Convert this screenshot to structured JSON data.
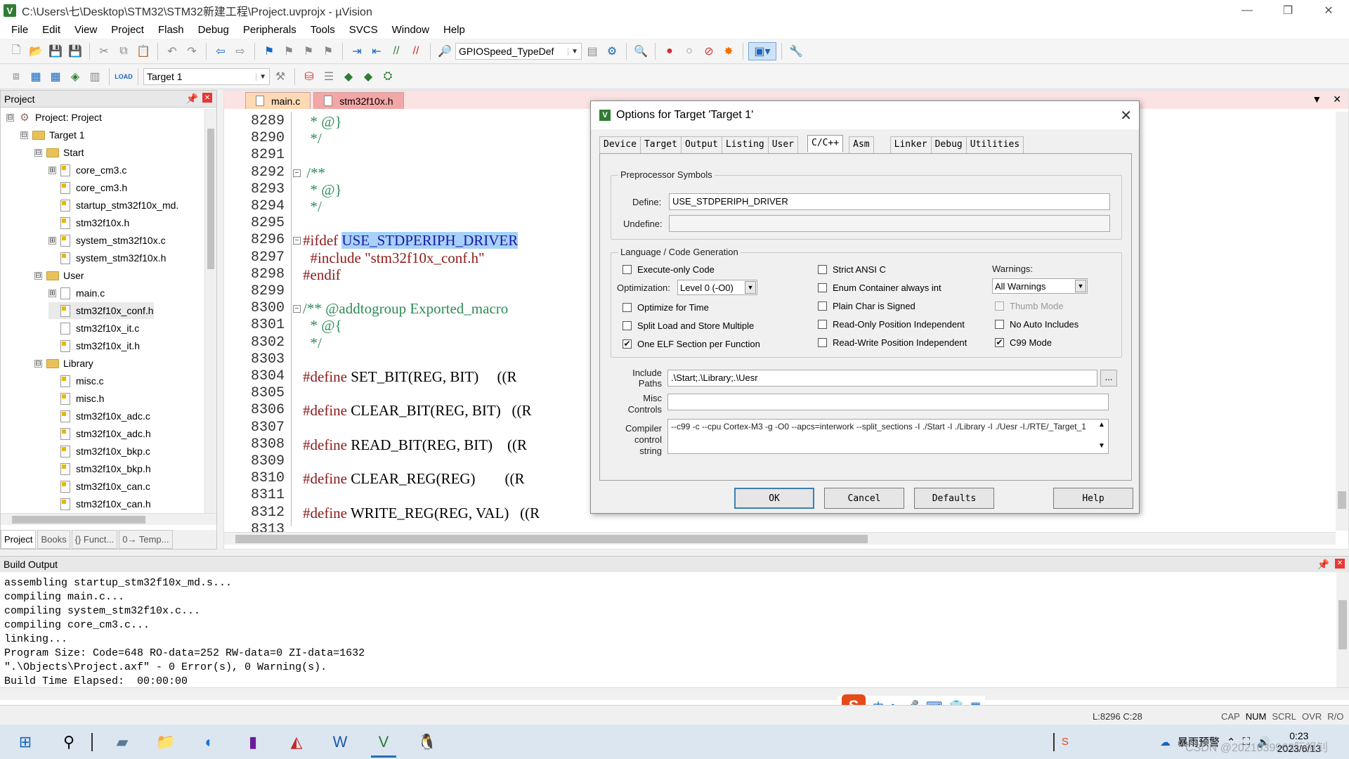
{
  "window": {
    "title": "C:\\Users\\七\\Desktop\\STM32\\STM32新建工程\\Project.uvprojx - µVision",
    "app_icon": "V",
    "minimize": "—",
    "restore": "❐",
    "close": "✕"
  },
  "menu": [
    "File",
    "Edit",
    "View",
    "Project",
    "Flash",
    "Debug",
    "Peripherals",
    "Tools",
    "SVCS",
    "Window",
    "Help"
  ],
  "toolbar": {
    "find_combo": "GPIOSpeed_TypeDef",
    "target_combo": "Target 1",
    "load_label": "LOAD"
  },
  "project_panel": {
    "title": "Project",
    "tree": [
      {
        "label": "Project: Project",
        "level": 0,
        "kind": "project",
        "exp": "⊟"
      },
      {
        "label": "Target 1",
        "level": 1,
        "kind": "target",
        "exp": "⊟"
      },
      {
        "label": "Start",
        "level": 2,
        "kind": "folder",
        "exp": "⊟"
      },
      {
        "label": "core_cm3.c",
        "level": 3,
        "kind": "file",
        "exp": "⊞"
      },
      {
        "label": "core_cm3.h",
        "level": 3,
        "kind": "file",
        "exp": ""
      },
      {
        "label": "startup_stm32f10x_md.",
        "level": 3,
        "kind": "file",
        "exp": ""
      },
      {
        "label": "stm32f10x.h",
        "level": 3,
        "kind": "file",
        "exp": ""
      },
      {
        "label": "system_stm32f10x.c",
        "level": 3,
        "kind": "file",
        "exp": "⊞"
      },
      {
        "label": "system_stm32f10x.h",
        "level": 3,
        "kind": "file",
        "exp": ""
      },
      {
        "label": "User",
        "level": 2,
        "kind": "folder",
        "exp": "⊟"
      },
      {
        "label": "main.c",
        "level": 3,
        "kind": "file",
        "exp": "⊞"
      },
      {
        "label": "stm32f10x_conf.h",
        "level": 3,
        "kind": "file",
        "exp": ""
      },
      {
        "label": "stm32f10x_it.c",
        "level": 3,
        "kind": "file",
        "exp": ""
      },
      {
        "label": "stm32f10x_it.h",
        "level": 3,
        "kind": "file",
        "exp": ""
      },
      {
        "label": "Library",
        "level": 2,
        "kind": "folder",
        "exp": "⊟"
      },
      {
        "label": "misc.c",
        "level": 3,
        "kind": "file",
        "exp": ""
      },
      {
        "label": "misc.h",
        "level": 3,
        "kind": "file",
        "exp": ""
      },
      {
        "label": "stm32f10x_adc.c",
        "level": 3,
        "kind": "file",
        "exp": ""
      },
      {
        "label": "stm32f10x_adc.h",
        "level": 3,
        "kind": "file",
        "exp": ""
      },
      {
        "label": "stm32f10x_bkp.c",
        "level": 3,
        "kind": "file",
        "exp": ""
      },
      {
        "label": "stm32f10x_bkp.h",
        "level": 3,
        "kind": "file",
        "exp": ""
      },
      {
        "label": "stm32f10x_can.c",
        "level": 3,
        "kind": "file",
        "exp": ""
      },
      {
        "label": "stm32f10x_can.h",
        "level": 3,
        "kind": "file",
        "exp": ""
      }
    ],
    "tabs": [
      "Project",
      "Books",
      "{} Funct...",
      "0→ Temp..."
    ]
  },
  "editor": {
    "tabs": [
      "main.c",
      "stm32f10x.h"
    ],
    "active_tab": "stm32f10x.h",
    "lines": [
      {
        "n": "8289",
        "text": "  * @}"
      },
      {
        "n": "8290",
        "text": "  */"
      },
      {
        "n": "8291",
        "text": ""
      },
      {
        "n": "8292",
        "text": " /**"
      },
      {
        "n": "8293",
        "text": "  * @}"
      },
      {
        "n": "8294",
        "text": "  */"
      },
      {
        "n": "8295",
        "text": ""
      },
      {
        "n": "8296",
        "text": "#ifdef USE_STDPERIPH_DRIVER"
      },
      {
        "n": "8297",
        "text": "  #include \"stm32f10x_conf.h\""
      },
      {
        "n": "8298",
        "text": "#endif"
      },
      {
        "n": "8299",
        "text": ""
      },
      {
        "n": "8300",
        "text": "/** @addtogroup Exported_macro"
      },
      {
        "n": "8301",
        "text": "  * @{"
      },
      {
        "n": "8302",
        "text": "  */"
      },
      {
        "n": "8303",
        "text": ""
      },
      {
        "n": "8304",
        "text": "#define SET_BIT(REG, BIT)     ((R"
      },
      {
        "n": "8305",
        "text": ""
      },
      {
        "n": "8306",
        "text": "#define CLEAR_BIT(REG, BIT)   ((R"
      },
      {
        "n": "8307",
        "text": ""
      },
      {
        "n": "8308",
        "text": "#define READ_BIT(REG, BIT)    ((R"
      },
      {
        "n": "8309",
        "text": ""
      },
      {
        "n": "8310",
        "text": "#define CLEAR_REG(REG)        ((R"
      },
      {
        "n": "8311",
        "text": ""
      },
      {
        "n": "8312",
        "text": "#define WRITE_REG(REG, VAL)   ((R"
      },
      {
        "n": "8313",
        "text": ""
      }
    ]
  },
  "dialog": {
    "title": "Options for Target 'Target 1'",
    "tabs": [
      "Device",
      "Target",
      "Output",
      "Listing",
      "User",
      "C/C++",
      "Asm",
      "Linker",
      "Debug",
      "Utilities"
    ],
    "active_tab": "C/C++",
    "preprocessor": {
      "group": "Preprocessor Symbols",
      "define_label": "Define:",
      "define_value": "USE_STDPERIPH_DRIVER",
      "undefine_label": "Undefine:",
      "undefine_value": ""
    },
    "codegen": {
      "group": "Language / Code Generation",
      "optimization_label": "Optimization:",
      "optimization_value": "Level 0 (-O0)",
      "warnings_label": "Warnings:",
      "warnings_value": "All Warnings",
      "checkboxes": [
        {
          "label": "Execute-only Code",
          "checked": false,
          "disabled": false
        },
        {
          "label": "Optimize for Time",
          "checked": false,
          "disabled": false
        },
        {
          "label": "Split Load and Store Multiple",
          "checked": false,
          "disabled": false
        },
        {
          "label": "One ELF Section per Function",
          "checked": true,
          "disabled": false
        },
        {
          "label": "Strict ANSI C",
          "checked": false,
          "disabled": false
        },
        {
          "label": "Enum Container always int",
          "checked": false,
          "disabled": false
        },
        {
          "label": "Plain Char is Signed",
          "checked": false,
          "disabled": false
        },
        {
          "label": "Read-Only Position Independent",
          "checked": false,
          "disabled": false
        },
        {
          "label": "Read-Write Position Independent",
          "checked": false,
          "disabled": false
        },
        {
          "label": "Thumb Mode",
          "checked": false,
          "disabled": true
        },
        {
          "label": "No Auto Includes",
          "checked": false,
          "disabled": false
        },
        {
          "label": "C99 Mode",
          "checked": true,
          "disabled": false
        }
      ]
    },
    "include_label_1": "Include",
    "include_label_2": "Paths",
    "include_value": ".\\Start;.\\Library;.\\Uesr",
    "browse_label": "...",
    "misc_label_1": "Misc",
    "misc_label_2": "Controls",
    "misc_value": "",
    "compiler_label_1": "Compiler",
    "compiler_label_2": "control",
    "compiler_label_3": "string",
    "compiler_value": "--c99 -c --cpu Cortex-M3 -g -O0 --apcs=interwork --split_sections -I ./Start -I ./Library -I ./Uesr -I./RTE/_Target_1",
    "buttons": {
      "ok": "OK",
      "cancel": "Cancel",
      "defaults": "Defaults",
      "help": "Help"
    }
  },
  "build_output": {
    "title": "Build Output",
    "lines": [
      "assembling startup_stm32f10x_md.s...",
      "compiling main.c...",
      "compiling system_stm32f10x.c...",
      "compiling core_cm3.c...",
      "linking...",
      "Program Size: Code=648 RO-data=252 RW-data=0 ZI-data=1632",
      "\".\\Objects\\Project.axf\" - 0 Error(s), 0 Warning(s).",
      "Build Time Elapsed:  00:00:00"
    ]
  },
  "statusbar": {
    "position": "L:8296 C:28",
    "keys": [
      "CAP",
      "NUM",
      "SCRL",
      "OVR",
      "R/O"
    ]
  },
  "ime": {
    "logo": "S",
    "lang": "中",
    "items": [
      "•,",
      "🎤",
      "⌨",
      "👕",
      "▦"
    ]
  },
  "taskbar": {
    "weather": "暴雨预警",
    "time": "0:23",
    "date": "2023/6/13",
    "watermark": "CSDN @2021039963阮祖钊"
  }
}
